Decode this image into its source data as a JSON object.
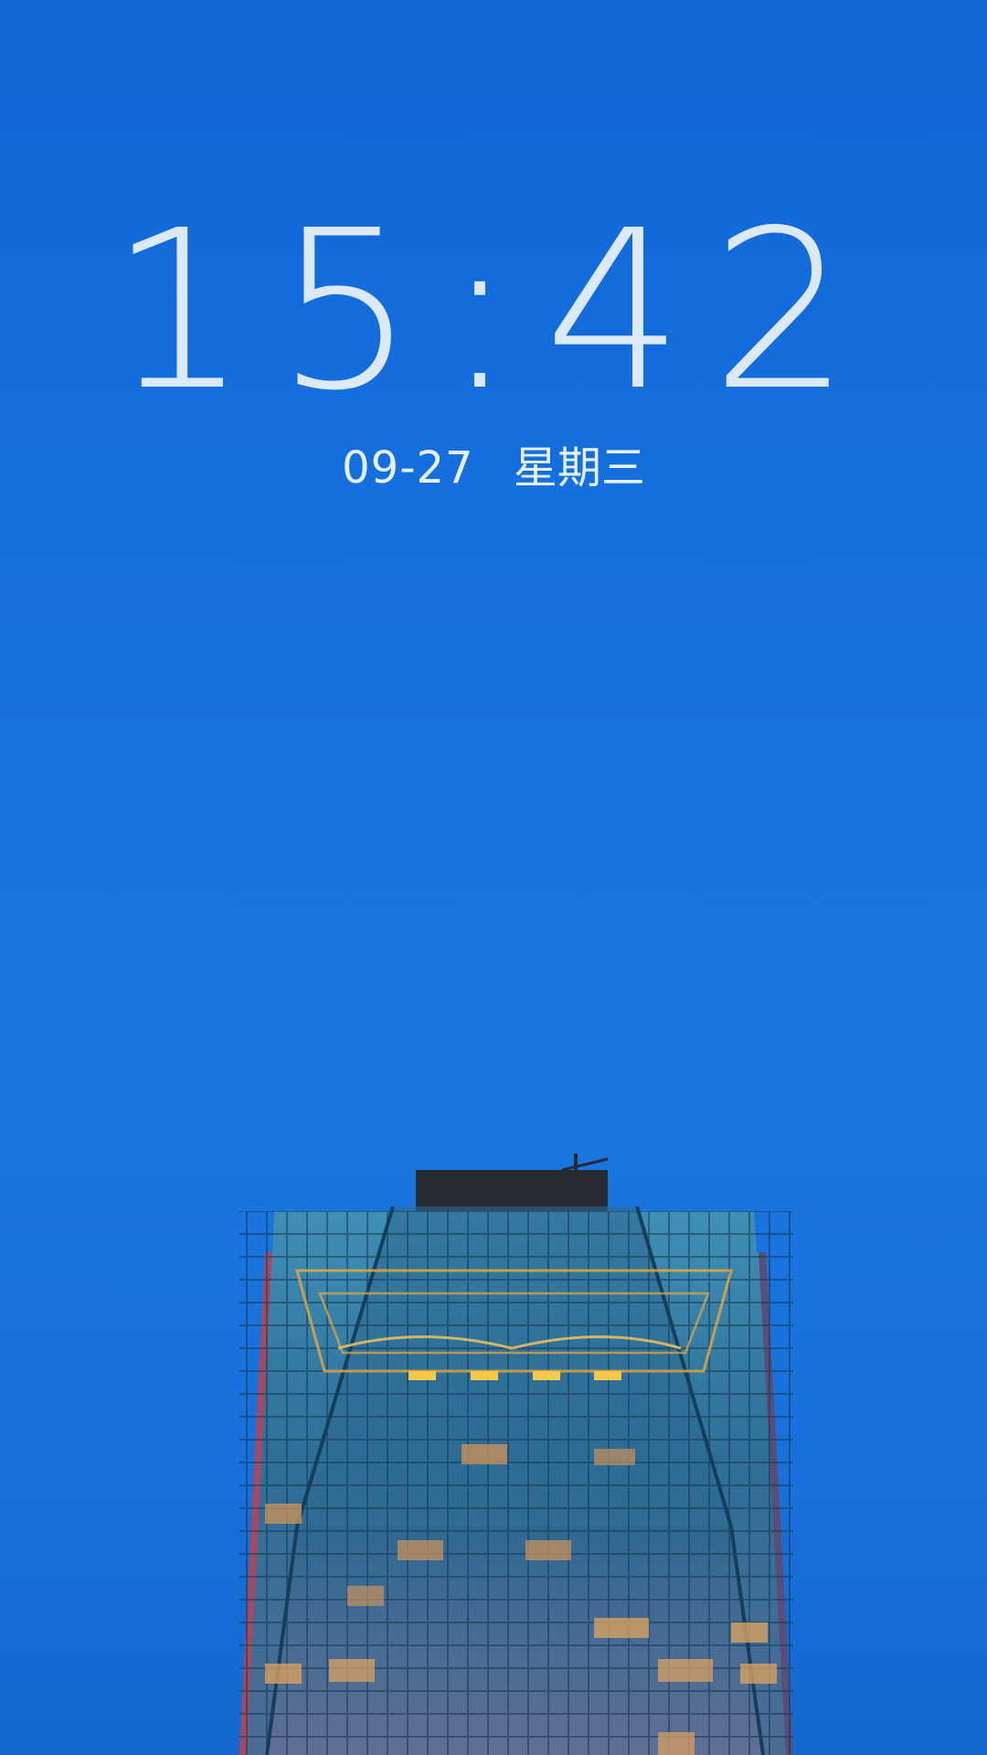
{
  "lockscreen": {
    "time": "15:42",
    "date": "09-27",
    "weekday": "星期三"
  },
  "colors": {
    "sky": "#1570df",
    "text": "#e6f0fb",
    "building_glass": "#2f6f9a",
    "window_light": "#f2b84b"
  },
  "wallpaper": {
    "subject": "skyscraper-photo"
  }
}
